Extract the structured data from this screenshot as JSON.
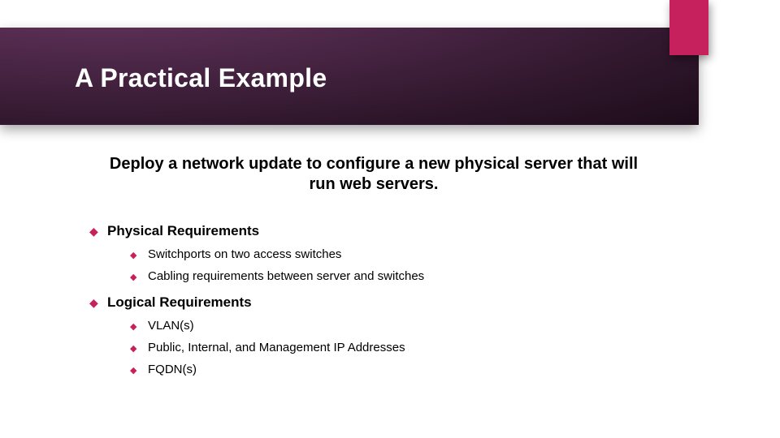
{
  "title": "A Practical Example",
  "subtitle": "Deploy a network update to configure a new physical server that will run web servers.",
  "sections": [
    {
      "heading": "Physical Requirements",
      "items": [
        "Switchports on two access switches",
        "Cabling requirements between server and switches"
      ]
    },
    {
      "heading": "Logical Requirements",
      "items": [
        "VLAN(s)",
        "Public, Internal, and Management IP Addresses",
        "FQDN(s)"
      ]
    }
  ]
}
